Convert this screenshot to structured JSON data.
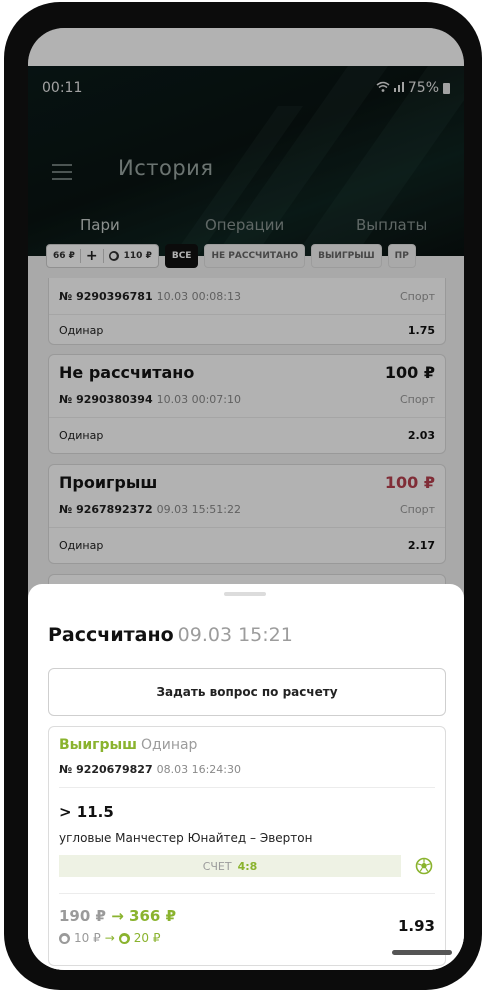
{
  "status_bar": {
    "time": "00:11",
    "signal": "•••",
    "battery": "75%"
  },
  "header": {
    "title": "История",
    "menu_icon": "hamburger-icon"
  },
  "tabs": [
    {
      "label": "Пари",
      "active": true
    },
    {
      "label": "Операции",
      "active": false
    },
    {
      "label": "Выплаты",
      "active": false
    }
  ],
  "filters": {
    "balance": "66 ₽",
    "add": "+",
    "bonus": "110 ₽",
    "bonus_symbol": "●",
    "chips": [
      "ВСЕ",
      "НЕ РАССЧИТАНО",
      "ВЫИГРЫШ",
      "ПР"
    ]
  },
  "bets": [
    {
      "status": "",
      "amount": "",
      "number": "№ 9290396781",
      "date": "10.03  00:08:13",
      "sport": "Спорт",
      "type": "Одинар",
      "coef": "1.75"
    },
    {
      "status": "Не рассчитано",
      "amount": "100 ₽",
      "number": "№ 9290380394",
      "date": "10.03  00:07:10",
      "sport": "Спорт",
      "type": "Одинар",
      "coef": "2.03"
    },
    {
      "status": "Проигрыш",
      "amount": "100 ₽",
      "number": "№ 9267892372",
      "date": "09.03  15:51:22",
      "sport": "Спорт",
      "type": "Одинар",
      "coef": "2.17"
    }
  ],
  "colors": {
    "loss": "#b8414f",
    "win": "#8ab32e"
  },
  "sheet": {
    "title": "Рассчитано",
    "datetime": "09.03 15:21",
    "ask_button": "Задать вопрос по расчету",
    "result": "Выигрыш",
    "bet_kind": "Одинар",
    "number": "№ 9220679827",
    "date": "08.03  16:24:30",
    "outcome": "> 11.5",
    "event": "угловые Манчестер Юнайтед – Эвертон",
    "score_label": "СЧЕТ",
    "score": "4:8",
    "stake": "190 ₽",
    "arrow": "→",
    "payout": "366 ₽",
    "bonus_from": "10 ₽",
    "bonus_to": "20 ₽",
    "coef": "1.93"
  }
}
